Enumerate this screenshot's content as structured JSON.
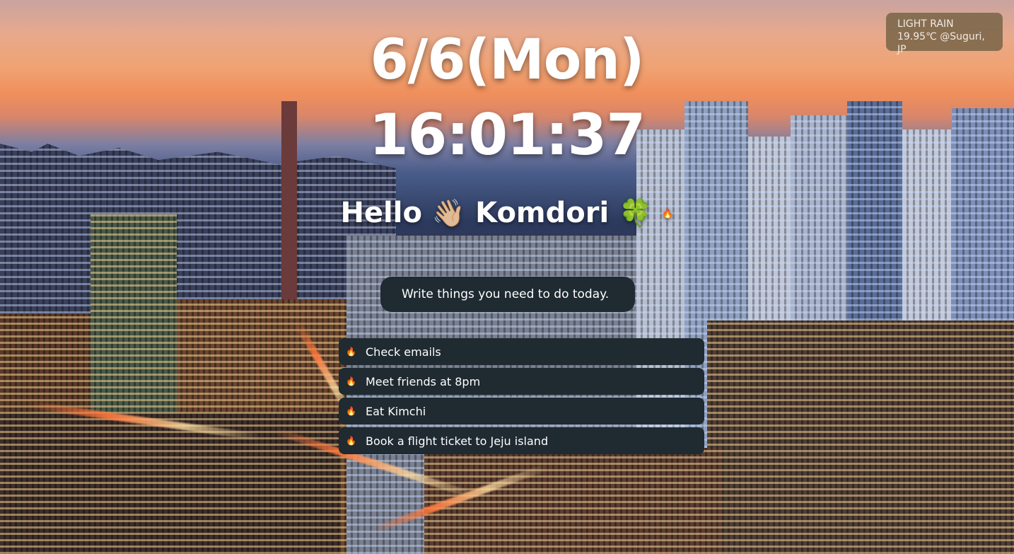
{
  "weather": {
    "condition": "LIGHT RAIN",
    "detail": "19.95℃ @Suguri, JP"
  },
  "clock": {
    "date": "6/6(Mon)",
    "time": "16:01:37"
  },
  "greeting": {
    "hello": "Hello",
    "wave_emoji": "👋🏼",
    "name": "Komdori",
    "clover_emoji": "🍀",
    "fire_emoji": "🔥"
  },
  "todo": {
    "placeholder": "Write things you need to do today.",
    "items": [
      {
        "icon": "🔥",
        "text": "Check emails"
      },
      {
        "icon": "🔥",
        "text": "Meet friends at 8pm"
      },
      {
        "icon": "🔥",
        "text": "Eat Kimchi"
      },
      {
        "icon": "🔥",
        "text": "Book a flight ticket to Jeju island"
      }
    ]
  }
}
